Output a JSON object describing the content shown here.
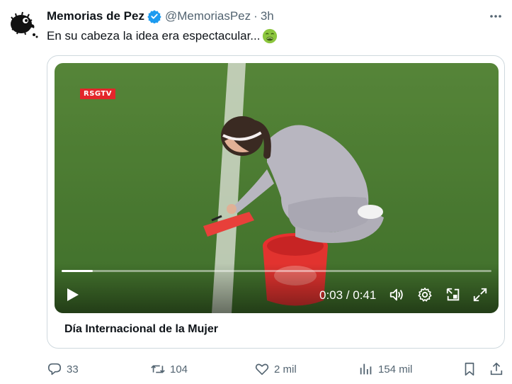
{
  "author": {
    "name": "Memorias de Pez",
    "handle": "@MemoriasPez",
    "separator": "·",
    "time": "3h"
  },
  "tweet": {
    "text": "En su cabeza la idea era espectacular...",
    "emoji": "nauseated-face-emoji"
  },
  "video": {
    "channel_logo": "RSGTV",
    "time_display": "0:03 / 0:41",
    "progress": 0.073,
    "caption": "Día Internacional de la Mujer"
  },
  "actions": {
    "replies": "33",
    "retweets": "104",
    "likes": "2 mil",
    "views": "154 mil"
  },
  "colors": {
    "verified": "#1d9bf0",
    "secondary_text": "#536471",
    "border": "#cfd9de",
    "grass": "#4f7f36",
    "logo_red": "#e3262b"
  }
}
